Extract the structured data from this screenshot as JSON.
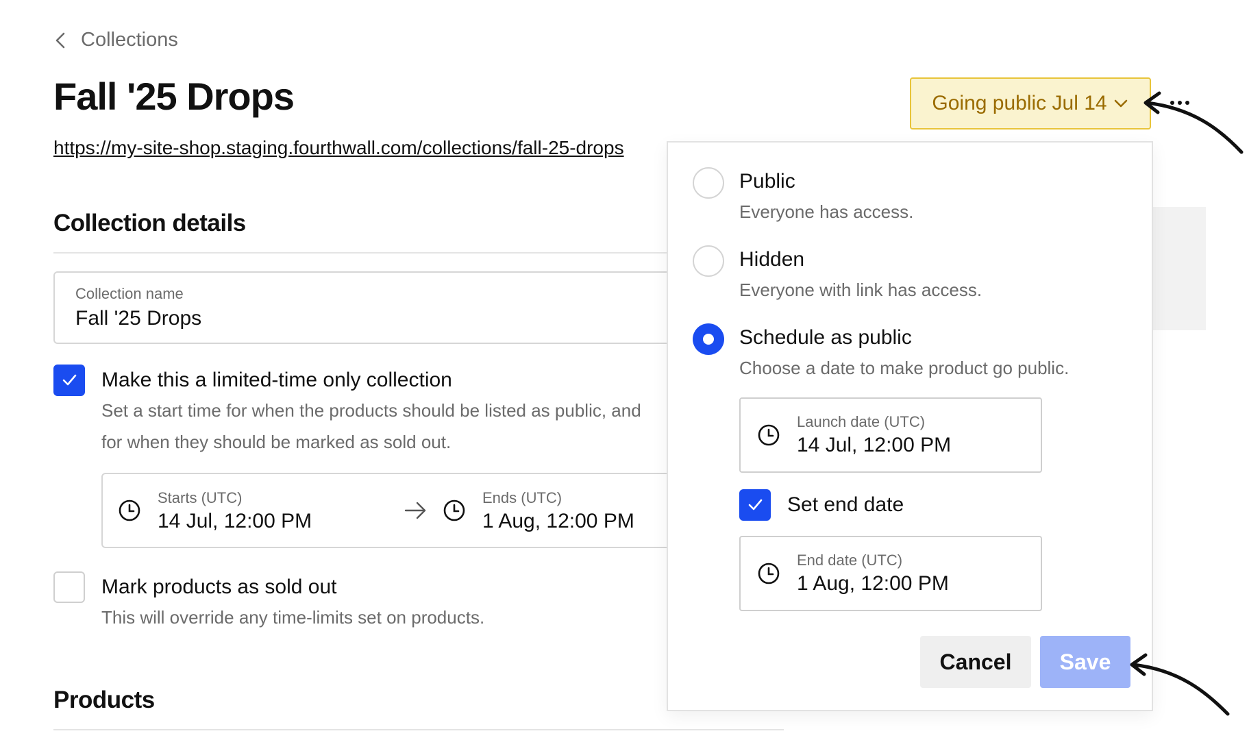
{
  "breadcrumb": {
    "label": "Collections",
    "icon": "chevron-left-icon"
  },
  "page": {
    "title": "Fall '25 Drops",
    "url": "https://my-site-shop.staging.fourthwall.com/collections/fall-25-drops"
  },
  "details": {
    "section_title": "Collection details",
    "name_field": {
      "label": "Collection name",
      "value": "Fall '25 Drops"
    },
    "limited_time": {
      "checked": true,
      "title": "Make this a limited-time only collection",
      "desc_line1": "Set a start time for when the products should be listed as public, and",
      "desc_line2": "for when they should be marked as sold out."
    },
    "range": {
      "start_label": "Starts (UTC)",
      "start_value": "14 Jul, 12:00 PM",
      "end_label": "Ends (UTC)",
      "end_value": "1 Aug, 12:00 PM"
    },
    "sold_out": {
      "checked": false,
      "title": "Mark products as sold out",
      "desc": "This will override any time-limits set on products."
    }
  },
  "products": {
    "section_title": "Products"
  },
  "status_button": {
    "label": "Going public Jul 14",
    "icon": "chevron-down-icon"
  },
  "more_button": {
    "icon": "ellipsis-icon"
  },
  "visibility_popover": {
    "options": [
      {
        "title": "Public",
        "desc": "Everyone has access.",
        "selected": false
      },
      {
        "title": "Hidden",
        "desc": "Everyone with link has access.",
        "selected": false
      },
      {
        "title": "Schedule as public",
        "desc": "Choose a date to make product go public.",
        "selected": true
      }
    ],
    "launch_date": {
      "label": "Launch date (UTC)",
      "value": "14 Jul, 12:00 PM"
    },
    "set_end_date": {
      "checked": true,
      "label": "Set end date"
    },
    "end_date": {
      "label": "End date (UTC)",
      "value": "1 Aug, 12:00 PM"
    },
    "cancel_label": "Cancel",
    "save_label": "Save"
  },
  "colors": {
    "accent": "#1a4cf0",
    "status_bg": "#faf3cf",
    "status_border": "#e8c43a",
    "status_text": "#9a6b00",
    "save_disabled": "#9db3f8"
  }
}
